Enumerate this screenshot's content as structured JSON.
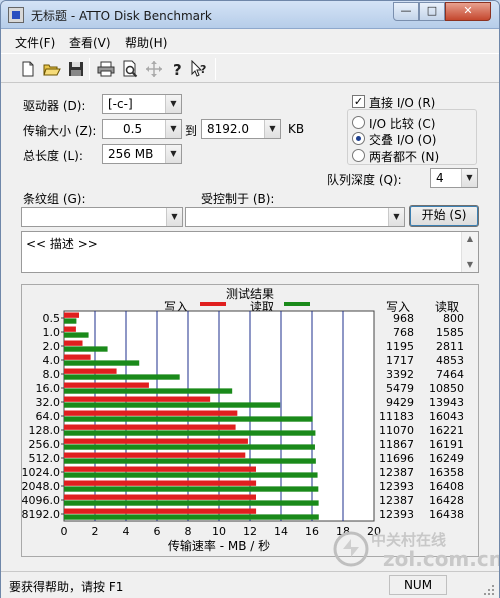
{
  "window": {
    "title": "无标题 - ATTO Disk Benchmark",
    "min_glyph": "—",
    "max_glyph": "□",
    "close_glyph": "✕"
  },
  "menu": [
    "文件(F)",
    "查看(V)",
    "帮助(H)"
  ],
  "toolbar_icons": [
    "new-file-icon",
    "open-folder-icon",
    "save-icon",
    "print-icon",
    "print-preview-icon",
    "move-icon",
    "help-icon",
    "context-help-icon"
  ],
  "settings": {
    "drive_label": "驱动器 (D):",
    "drive_value": "[-c-]",
    "transfer_label": "传输大小 (Z):",
    "transfer_from": "0.5",
    "transfer_to_label": "到",
    "transfer_to": "8192.0",
    "transfer_unit": "KB",
    "length_label": "总长度 (L):",
    "length_value": "256 MB",
    "direct_io_label": "直接 I/O (R)",
    "direct_io_checked": true,
    "io_compare_label": "I/O 比较 (C)",
    "io_overlap_label": "交叠 I/O (O)",
    "io_neither_label": "两者都不 (N)",
    "io_selected": "overlap",
    "queue_label": "队列深度 (Q):",
    "queue_value": "4",
    "stripe_label": "条纹组 (G):",
    "controlled_label": "受控制于 (B):",
    "start_label": "开始 (S)",
    "description": "<< 描述 >>"
  },
  "chart_data": {
    "type": "bar",
    "title": "测试结果",
    "legend": [
      {
        "name": "写入",
        "color": "#e01f1f"
      },
      {
        "name": "读取",
        "color": "#1a8a1a"
      }
    ],
    "xlabel": "传输速率 - MB / 秒",
    "xlim": [
      0,
      20
    ],
    "xticks": [
      "0",
      "2",
      "4",
      "6",
      "8",
      "10",
      "12",
      "14",
      "16",
      "18",
      "20"
    ],
    "categories": [
      "0.5",
      "1.0",
      "2.0",
      "4.0",
      "8.0",
      "16.0",
      "32.0",
      "64.0",
      "128.0",
      "256.0",
      "512.0",
      "1024.0",
      "2048.0",
      "4096.0",
      "8192.0"
    ],
    "series": [
      {
        "name": "写入",
        "values": [
          968,
          768,
          1195,
          1717,
          3392,
          5479,
          9429,
          11183,
          11070,
          11867,
          11696,
          12387,
          12393,
          12387,
          12393
        ]
      },
      {
        "name": "读取",
        "values": [
          800,
          1585,
          2811,
          4853,
          7464,
          10850,
          13943,
          16043,
          16221,
          16191,
          16249,
          16358,
          16408,
          16428,
          16438
        ]
      }
    ],
    "column_headers": [
      "写入",
      "读取"
    ],
    "value_unit_divisor": 1000
  },
  "status": {
    "text": "要获得帮助，请按 F1",
    "num": "NUM"
  },
  "watermark": {
    "cn": "中关村在线",
    "url": "zol.com.cn"
  }
}
